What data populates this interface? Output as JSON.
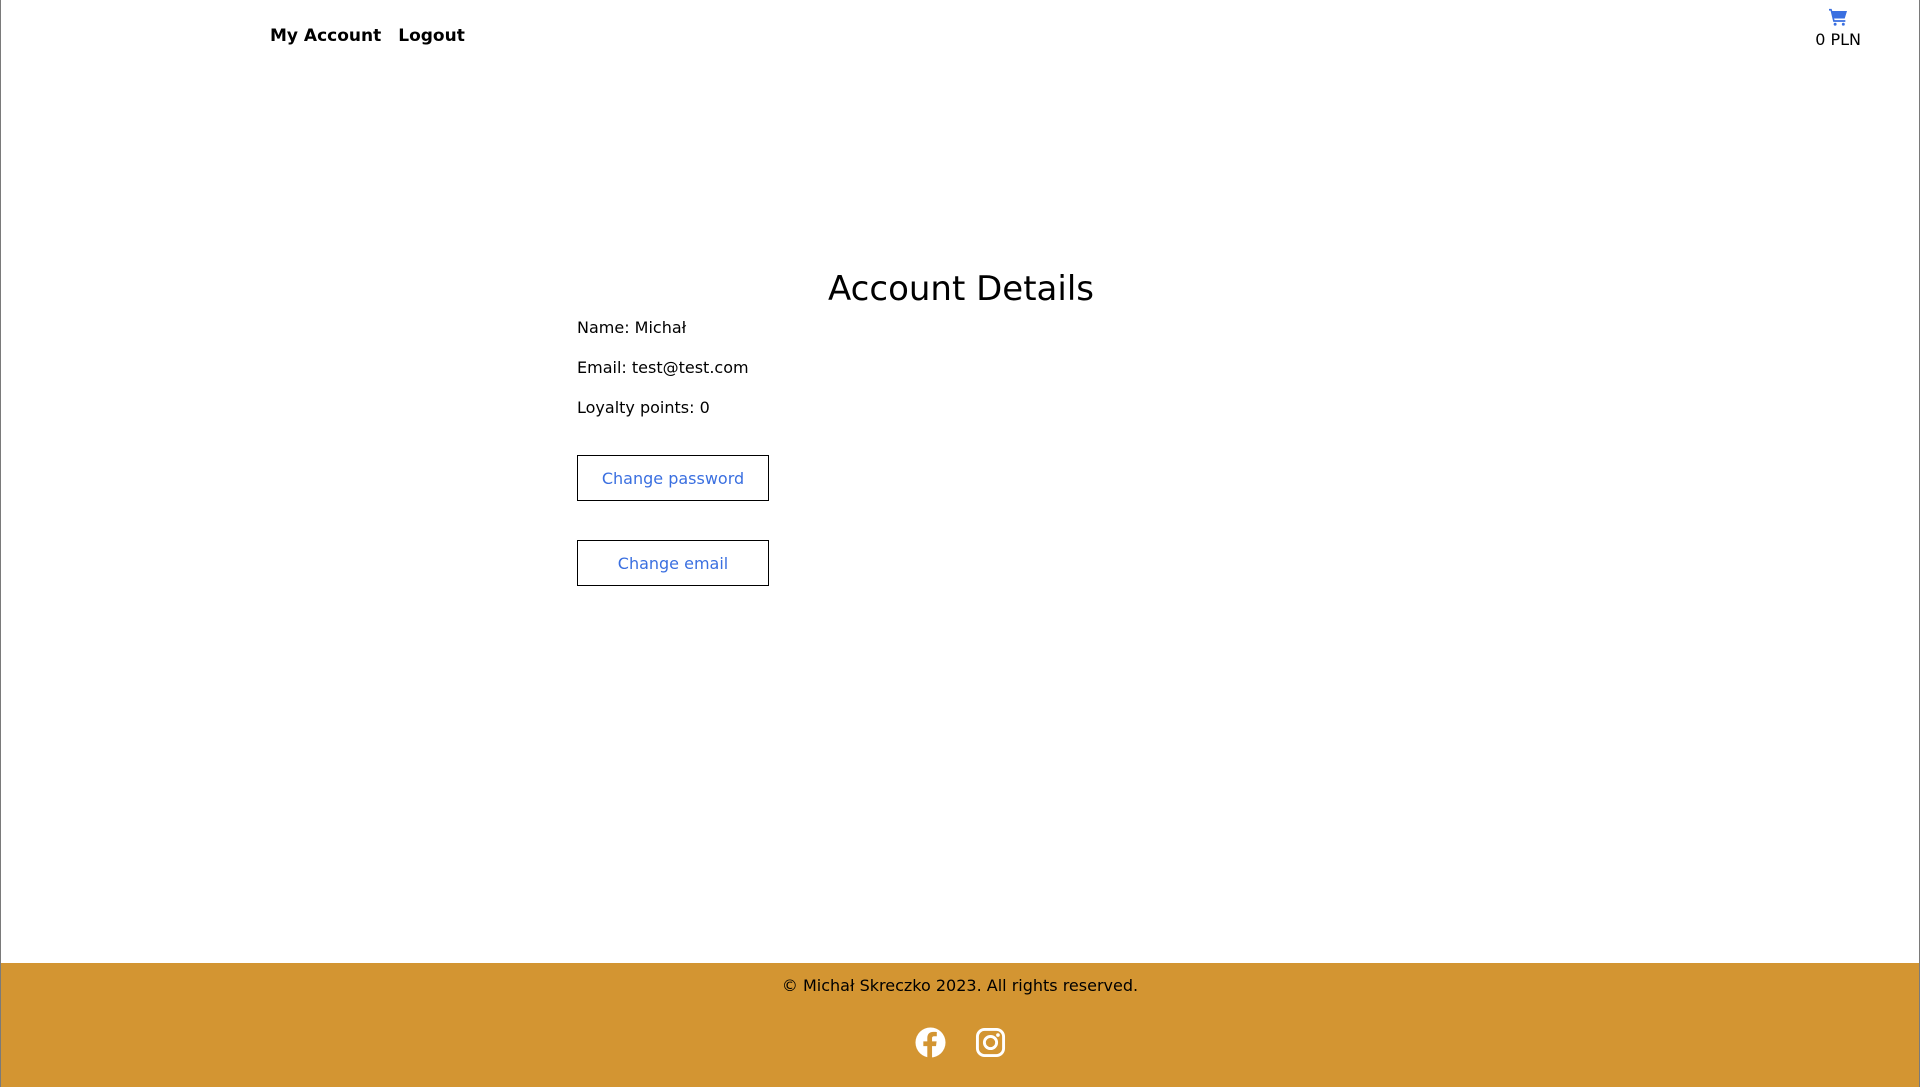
{
  "header": {
    "nav": [
      {
        "label": "My Account"
      },
      {
        "label": "Logout"
      }
    ],
    "cart": {
      "icon": "cart-icon",
      "total": "0 PLN"
    }
  },
  "main": {
    "title": "Account Details",
    "details": {
      "name": "Name: Michał",
      "email": "Email: test@test.com",
      "loyalty": "Loyalty points: 0"
    },
    "buttons": {
      "change_password": "Change password",
      "change_email": "Change email"
    }
  },
  "footer": {
    "copyright": "© Michał Skreczko 2023. All rights reserved.",
    "social": [
      {
        "icon": "facebook-icon"
      },
      {
        "icon": "instagram-icon"
      }
    ]
  },
  "colors": {
    "accent": "#3a6fe0",
    "footer_bg": "#d39532"
  }
}
